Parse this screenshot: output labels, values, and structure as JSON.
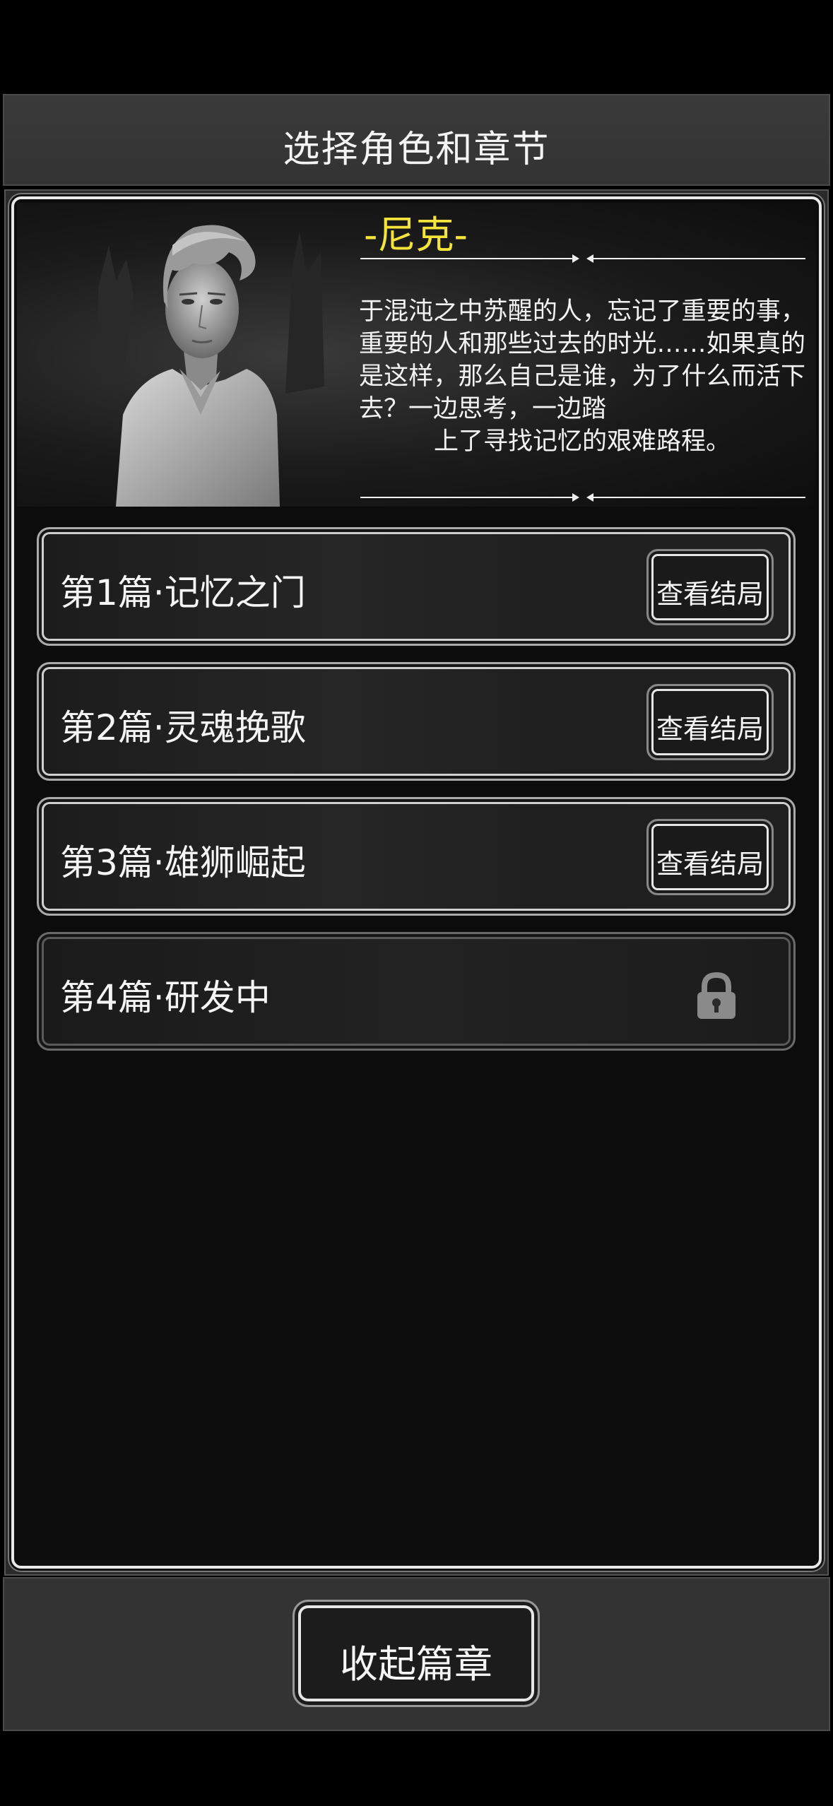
{
  "header": {
    "title": "选择角色和章节"
  },
  "character": {
    "name": "-尼克-",
    "description": "于混沌之中苏醒的人，忘记了重要的事，重要的人和那些过去的时光……如果真的是这样，那么自己是谁，为了什么而活下去？一边思考，一边踏",
    "description_last": "上了寻找记忆的艰难路程。"
  },
  "chapters": [
    {
      "title": "第1篇·记忆之门",
      "action": "查看结局",
      "locked": false
    },
    {
      "title": "第2篇·灵魂挽歌",
      "action": "查看结局",
      "locked": false
    },
    {
      "title": "第3篇·雄狮崛起",
      "action": "查看结局",
      "locked": false
    },
    {
      "title": "第4篇·研发中",
      "action": "",
      "locked": true
    }
  ],
  "footer": {
    "collapse_label": "收起篇章"
  },
  "colors": {
    "name": "#f3e33a",
    "border": "#e9e9e9",
    "background": "#0c0c0c"
  },
  "icons": [
    "padlock-icon"
  ]
}
